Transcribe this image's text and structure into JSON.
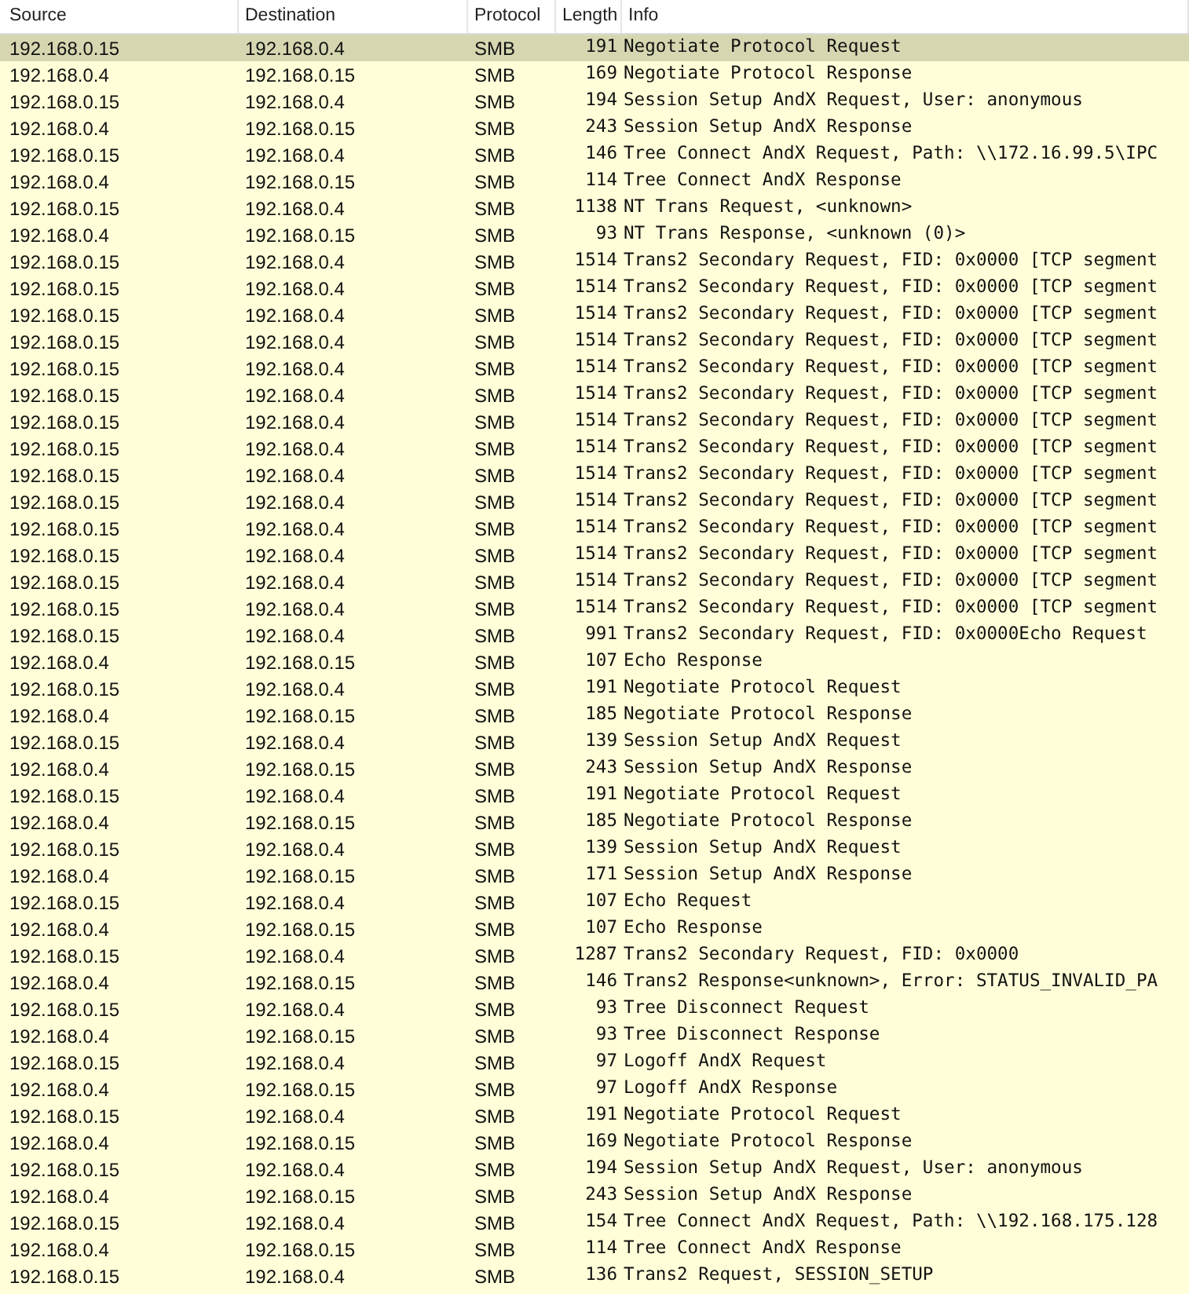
{
  "table": {
    "columns": [
      "Source",
      "Destination",
      "Protocol",
      "Length",
      "Info"
    ],
    "rows": [
      {
        "source": "192.168.0.15",
        "destination": "192.168.0.4",
        "protocol": "SMB",
        "length": "191",
        "info": "Negotiate Protocol Request",
        "selected": true
      },
      {
        "source": "192.168.0.4",
        "destination": "192.168.0.15",
        "protocol": "SMB",
        "length": "169",
        "info": "Negotiate Protocol Response",
        "selected": false
      },
      {
        "source": "192.168.0.15",
        "destination": "192.168.0.4",
        "protocol": "SMB",
        "length": "194",
        "info": "Session Setup AndX Request, User: anonymous",
        "selected": false
      },
      {
        "source": "192.168.0.4",
        "destination": "192.168.0.15",
        "protocol": "SMB",
        "length": "243",
        "info": "Session Setup AndX Response",
        "selected": false
      },
      {
        "source": "192.168.0.15",
        "destination": "192.168.0.4",
        "protocol": "SMB",
        "length": "146",
        "info": "Tree Connect AndX Request, Path: \\\\172.16.99.5\\IPC",
        "selected": false
      },
      {
        "source": "192.168.0.4",
        "destination": "192.168.0.15",
        "protocol": "SMB",
        "length": "114",
        "info": "Tree Connect AndX Response",
        "selected": false
      },
      {
        "source": "192.168.0.15",
        "destination": "192.168.0.4",
        "protocol": "SMB",
        "length": "1138",
        "info": "NT Trans Request, <unknown>",
        "selected": false
      },
      {
        "source": "192.168.0.4",
        "destination": "192.168.0.15",
        "protocol": "SMB",
        "length": "93",
        "info": "NT Trans Response, <unknown (0)>",
        "selected": false
      },
      {
        "source": "192.168.0.15",
        "destination": "192.168.0.4",
        "protocol": "SMB",
        "length": "1514",
        "info": "Trans2 Secondary Request, FID: 0x0000 [TCP segment",
        "selected": false
      },
      {
        "source": "192.168.0.15",
        "destination": "192.168.0.4",
        "protocol": "SMB",
        "length": "1514",
        "info": "Trans2 Secondary Request, FID: 0x0000 [TCP segment",
        "selected": false
      },
      {
        "source": "192.168.0.15",
        "destination": "192.168.0.4",
        "protocol": "SMB",
        "length": "1514",
        "info": "Trans2 Secondary Request, FID: 0x0000 [TCP segment",
        "selected": false
      },
      {
        "source": "192.168.0.15",
        "destination": "192.168.0.4",
        "protocol": "SMB",
        "length": "1514",
        "info": "Trans2 Secondary Request, FID: 0x0000 [TCP segment",
        "selected": false
      },
      {
        "source": "192.168.0.15",
        "destination": "192.168.0.4",
        "protocol": "SMB",
        "length": "1514",
        "info": "Trans2 Secondary Request, FID: 0x0000 [TCP segment",
        "selected": false
      },
      {
        "source": "192.168.0.15",
        "destination": "192.168.0.4",
        "protocol": "SMB",
        "length": "1514",
        "info": "Trans2 Secondary Request, FID: 0x0000 [TCP segment",
        "selected": false
      },
      {
        "source": "192.168.0.15",
        "destination": "192.168.0.4",
        "protocol": "SMB",
        "length": "1514",
        "info": "Trans2 Secondary Request, FID: 0x0000 [TCP segment",
        "selected": false
      },
      {
        "source": "192.168.0.15",
        "destination": "192.168.0.4",
        "protocol": "SMB",
        "length": "1514",
        "info": "Trans2 Secondary Request, FID: 0x0000 [TCP segment",
        "selected": false
      },
      {
        "source": "192.168.0.15",
        "destination": "192.168.0.4",
        "protocol": "SMB",
        "length": "1514",
        "info": "Trans2 Secondary Request, FID: 0x0000 [TCP segment",
        "selected": false
      },
      {
        "source": "192.168.0.15",
        "destination": "192.168.0.4",
        "protocol": "SMB",
        "length": "1514",
        "info": "Trans2 Secondary Request, FID: 0x0000 [TCP segment",
        "selected": false
      },
      {
        "source": "192.168.0.15",
        "destination": "192.168.0.4",
        "protocol": "SMB",
        "length": "1514",
        "info": "Trans2 Secondary Request, FID: 0x0000 [TCP segment",
        "selected": false
      },
      {
        "source": "192.168.0.15",
        "destination": "192.168.0.4",
        "protocol": "SMB",
        "length": "1514",
        "info": "Trans2 Secondary Request, FID: 0x0000 [TCP segment",
        "selected": false
      },
      {
        "source": "192.168.0.15",
        "destination": "192.168.0.4",
        "protocol": "SMB",
        "length": "1514",
        "info": "Trans2 Secondary Request, FID: 0x0000 [TCP segment",
        "selected": false
      },
      {
        "source": "192.168.0.15",
        "destination": "192.168.0.4",
        "protocol": "SMB",
        "length": "1514",
        "info": "Trans2 Secondary Request, FID: 0x0000 [TCP segment",
        "selected": false
      },
      {
        "source": "192.168.0.15",
        "destination": "192.168.0.4",
        "protocol": "SMB",
        "length": "991",
        "info": "Trans2 Secondary Request, FID: 0x0000Echo Request",
        "selected": false
      },
      {
        "source": "192.168.0.4",
        "destination": "192.168.0.15",
        "protocol": "SMB",
        "length": "107",
        "info": "Echo Response",
        "selected": false
      },
      {
        "source": "192.168.0.15",
        "destination": "192.168.0.4",
        "protocol": "SMB",
        "length": "191",
        "info": "Negotiate Protocol Request",
        "selected": false
      },
      {
        "source": "192.168.0.4",
        "destination": "192.168.0.15",
        "protocol": "SMB",
        "length": "185",
        "info": "Negotiate Protocol Response",
        "selected": false
      },
      {
        "source": "192.168.0.15",
        "destination": "192.168.0.4",
        "protocol": "SMB",
        "length": "139",
        "info": "Session Setup AndX Request",
        "selected": false
      },
      {
        "source": "192.168.0.4",
        "destination": "192.168.0.15",
        "protocol": "SMB",
        "length": "243",
        "info": "Session Setup AndX Response",
        "selected": false
      },
      {
        "source": "192.168.0.15",
        "destination": "192.168.0.4",
        "protocol": "SMB",
        "length": "191",
        "info": "Negotiate Protocol Request",
        "selected": false
      },
      {
        "source": "192.168.0.4",
        "destination": "192.168.0.15",
        "protocol": "SMB",
        "length": "185",
        "info": "Negotiate Protocol Response",
        "selected": false
      },
      {
        "source": "192.168.0.15",
        "destination": "192.168.0.4",
        "protocol": "SMB",
        "length": "139",
        "info": "Session Setup AndX Request",
        "selected": false
      },
      {
        "source": "192.168.0.4",
        "destination": "192.168.0.15",
        "protocol": "SMB",
        "length": "171",
        "info": "Session Setup AndX Response",
        "selected": false
      },
      {
        "source": "192.168.0.15",
        "destination": "192.168.0.4",
        "protocol": "SMB",
        "length": "107",
        "info": "Echo Request",
        "selected": false
      },
      {
        "source": "192.168.0.4",
        "destination": "192.168.0.15",
        "protocol": "SMB",
        "length": "107",
        "info": "Echo Response",
        "selected": false
      },
      {
        "source": "192.168.0.15",
        "destination": "192.168.0.4",
        "protocol": "SMB",
        "length": "1287",
        "info": "Trans2 Secondary Request, FID: 0x0000",
        "selected": false
      },
      {
        "source": "192.168.0.4",
        "destination": "192.168.0.15",
        "protocol": "SMB",
        "length": "146",
        "info": "Trans2 Response<unknown>, Error: STATUS_INVALID_PA",
        "selected": false
      },
      {
        "source": "192.168.0.15",
        "destination": "192.168.0.4",
        "protocol": "SMB",
        "length": "93",
        "info": "Tree Disconnect Request",
        "selected": false
      },
      {
        "source": "192.168.0.4",
        "destination": "192.168.0.15",
        "protocol": "SMB",
        "length": "93",
        "info": "Tree Disconnect Response",
        "selected": false
      },
      {
        "source": "192.168.0.15",
        "destination": "192.168.0.4",
        "protocol": "SMB",
        "length": "97",
        "info": "Logoff AndX Request",
        "selected": false
      },
      {
        "source": "192.168.0.4",
        "destination": "192.168.0.15",
        "protocol": "SMB",
        "length": "97",
        "info": "Logoff AndX Response",
        "selected": false
      },
      {
        "source": "192.168.0.15",
        "destination": "192.168.0.4",
        "protocol": "SMB",
        "length": "191",
        "info": "Negotiate Protocol Request",
        "selected": false
      },
      {
        "source": "192.168.0.4",
        "destination": "192.168.0.15",
        "protocol": "SMB",
        "length": "169",
        "info": "Negotiate Protocol Response",
        "selected": false
      },
      {
        "source": "192.168.0.15",
        "destination": "192.168.0.4",
        "protocol": "SMB",
        "length": "194",
        "info": "Session Setup AndX Request, User: anonymous",
        "selected": false
      },
      {
        "source": "192.168.0.4",
        "destination": "192.168.0.15",
        "protocol": "SMB",
        "length": "243",
        "info": "Session Setup AndX Response",
        "selected": false
      },
      {
        "source": "192.168.0.15",
        "destination": "192.168.0.4",
        "protocol": "SMB",
        "length": "154",
        "info": "Tree Connect AndX Request, Path: \\\\192.168.175.128",
        "selected": false
      },
      {
        "source": "192.168.0.4",
        "destination": "192.168.0.15",
        "protocol": "SMB",
        "length": "114",
        "info": "Tree Connect AndX Response",
        "selected": false
      },
      {
        "source": "192.168.0.15",
        "destination": "192.168.0.4",
        "protocol": "SMB",
        "length": "136",
        "info": "Trans2 Request, SESSION_SETUP",
        "selected": false
      }
    ]
  }
}
